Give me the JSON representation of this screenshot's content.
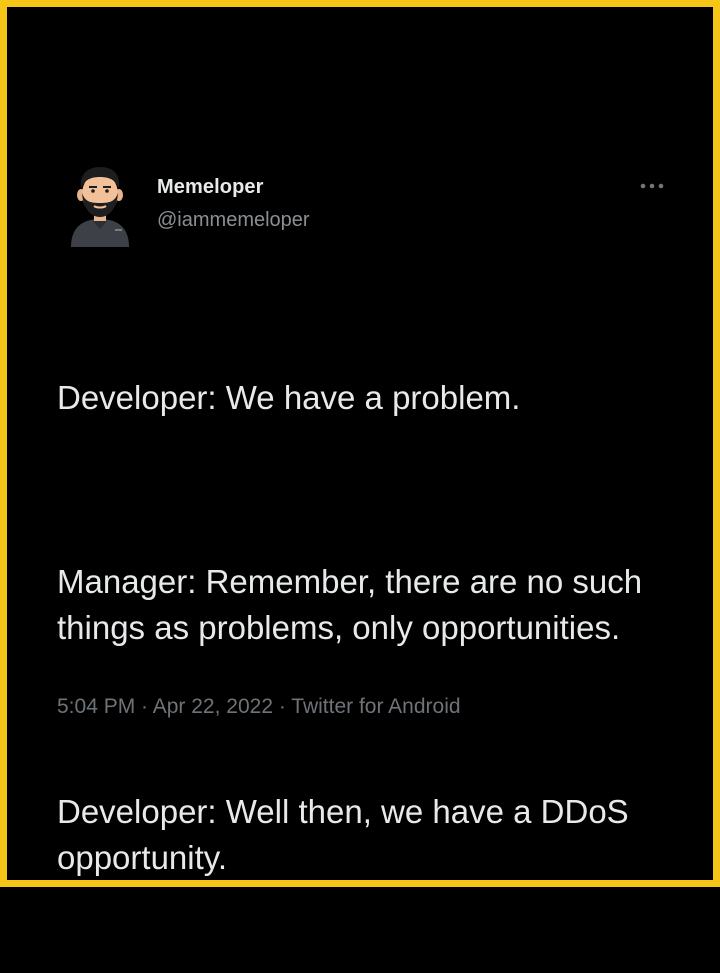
{
  "author": {
    "display_name": "Memeloper",
    "handle": "@iammemeloper",
    "avatar_icon": "bearded-developer-avatar-icon"
  },
  "more_icon": "more-horizontal-icon",
  "tweet": {
    "paragraphs": [
      "Developer: We have a problem.",
      "Manager: Remember, there are no such things as problems, only opportunities.",
      "Developer: Well then, we have a DDoS opportunity."
    ]
  },
  "meta": {
    "time": "5:04 PM",
    "separator": " · ",
    "date": "Apr 22, 2022",
    "source": "Twitter for Android"
  },
  "colors": {
    "border": "#f5c518",
    "background": "#000000",
    "text": "#e7e9ea",
    "secondary_text": "#8b8f94"
  }
}
